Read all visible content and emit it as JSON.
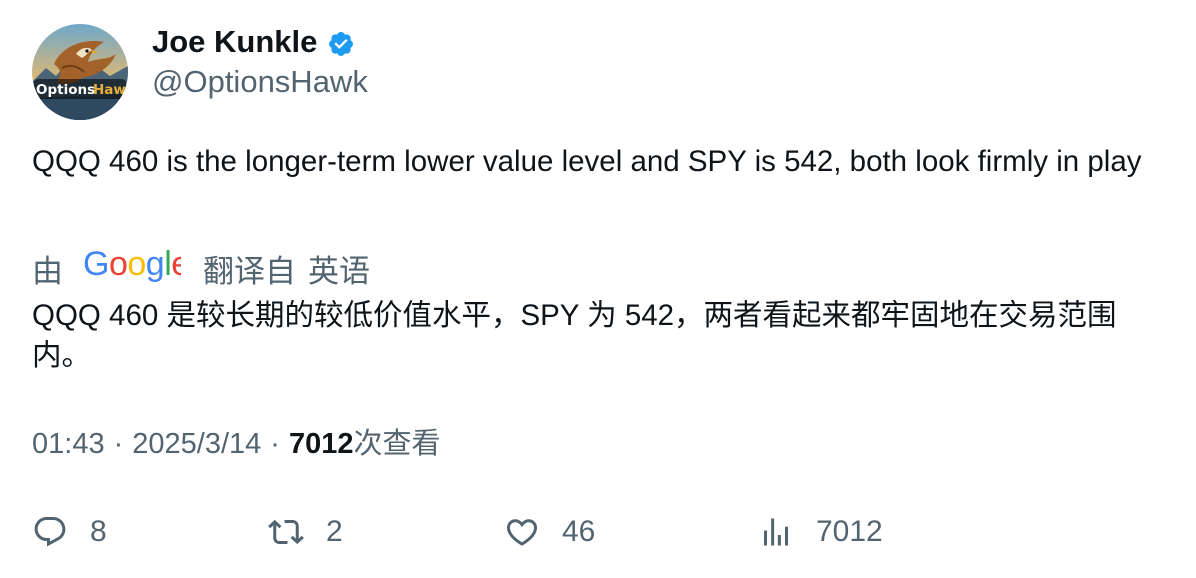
{
  "author": {
    "name": "Joe Kunkle",
    "handle": "@OptionsHawk",
    "avatar_logo_text": "OptionsHawk",
    "verified": true
  },
  "tweet": {
    "text": "QQQ 460 is the longer-term lower value level and SPY is 542, both look firmly in play"
  },
  "translation": {
    "prefix": "由",
    "provider": "Google",
    "label": "翻译自",
    "source_language": "英语",
    "text": "QQQ 460 是较长期的较低价值水平，SPY 为 542，两者看起来都牢固地在交易范围内。"
  },
  "meta": {
    "time": "01:43",
    "separator": "·",
    "date": "2025/3/14",
    "views_count": "7012",
    "views_label": "次查看"
  },
  "actions": {
    "reply_count": "8",
    "retweet_count": "2",
    "like_count": "46",
    "views_count": "7012"
  },
  "icons": {
    "avatar": "hawk-logo-avatar",
    "verified": "verified-badge-icon",
    "reply": "reply-icon",
    "retweet": "retweet-icon",
    "like": "heart-icon",
    "views": "views-chart-icon"
  },
  "colors": {
    "primary_text": "#0f1419",
    "secondary_text": "#536471",
    "verified_blue": "#1d9bf0"
  }
}
